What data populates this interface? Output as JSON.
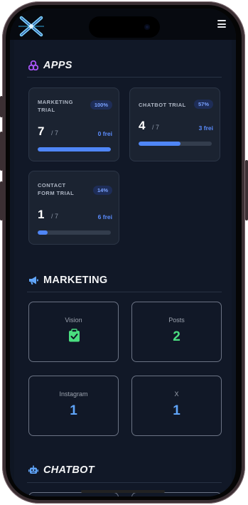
{
  "header": {
    "logo_icon": "x-brand-logo-icon",
    "menu_icon": "hamburger-menu-icon"
  },
  "apps": {
    "title": "APPS",
    "icon": "apps-cluster-icon",
    "icon_color": "#a855f7",
    "cards": [
      {
        "name": "MARKETING TRIAL",
        "percent": "100%",
        "count": "7",
        "total": "/ 7",
        "free": "0 frei",
        "progress": 1.0
      },
      {
        "name": "CHATBOT TRIAL",
        "percent": "57%",
        "count": "4",
        "total": "/ 7",
        "free": "3 frei",
        "progress": 0.57
      },
      {
        "name": "CONTACT FORM TRIAL",
        "percent": "14%",
        "count": "1",
        "total": "/ 7",
        "free": "6 frei",
        "progress": 0.14
      }
    ]
  },
  "marketing": {
    "title": "MARKETING",
    "icon": "megaphone-icon",
    "icon_color": "#60a5fa",
    "cards": [
      {
        "label": "Vision",
        "value": "",
        "icon": "clipboard-check-icon",
        "value_color": "#4ade80"
      },
      {
        "label": "Posts",
        "value": "2",
        "value_color": "#4ade80"
      },
      {
        "label": "Instagram",
        "value": "1",
        "value_color": "#60a5fa"
      },
      {
        "label": "X",
        "value": "1",
        "value_color": "#60a5fa"
      }
    ]
  },
  "chatbot": {
    "title": "CHATBOT",
    "icon": "robot-icon",
    "icon_color": "#60a5fa"
  }
}
